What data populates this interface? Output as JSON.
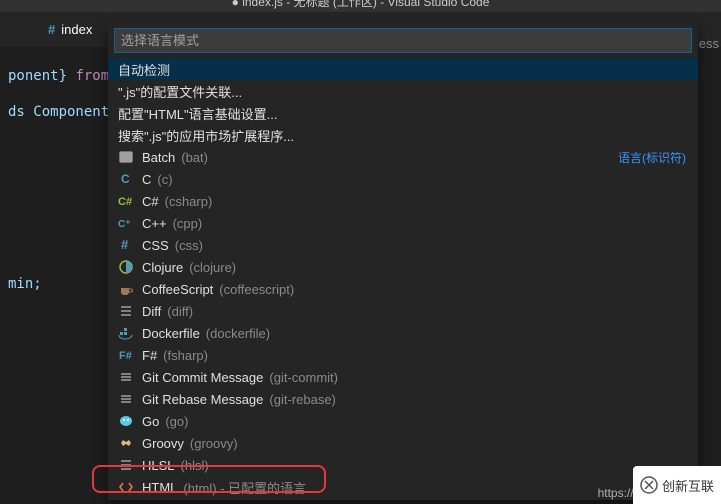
{
  "title": "● index.js - 无标题 (工作区) - Visual Studio Code",
  "tab": {
    "filename": "index"
  },
  "editor": {
    "line1_a": "ponent}",
    "line1_from": "from",
    "line2": "ds Component{",
    "line3": "min;"
  },
  "quickInput": {
    "placeholder": "选择语言模式",
    "rightHint": "语言(标识符)",
    "topItems": [
      "自动检测",
      "\".js\"的配置文件关联...",
      "配置\"HTML\"语言基础设置...",
      "搜索\".js\"的应用市场扩展程序..."
    ],
    "langs": [
      {
        "label": "Batch",
        "desc": "(bat)",
        "icon": "bat"
      },
      {
        "label": "C",
        "desc": "(c)",
        "icon": "c"
      },
      {
        "label": "C#",
        "desc": "(csharp)",
        "icon": "csharp"
      },
      {
        "label": "C++",
        "desc": "(cpp)",
        "icon": "cpp"
      },
      {
        "label": "CSS",
        "desc": "(css)",
        "icon": "css"
      },
      {
        "label": "Clojure",
        "desc": "(clojure)",
        "icon": "clojure"
      },
      {
        "label": "CoffeeScript",
        "desc": "(coffeescript)",
        "icon": "coffee"
      },
      {
        "label": "Diff",
        "desc": "(diff)",
        "icon": "diff"
      },
      {
        "label": "Dockerfile",
        "desc": "(dockerfile)",
        "icon": "docker"
      },
      {
        "label": "F#",
        "desc": "(fsharp)",
        "icon": "fsharp"
      },
      {
        "label": "Git Commit Message",
        "desc": "(git-commit)",
        "icon": "git"
      },
      {
        "label": "Git Rebase Message",
        "desc": "(git-rebase)",
        "icon": "git"
      },
      {
        "label": "Go",
        "desc": "(go)",
        "icon": "go"
      },
      {
        "label": "Groovy",
        "desc": "(groovy)",
        "icon": "groovy"
      },
      {
        "label": "HLSL",
        "desc": "(hlsl)",
        "icon": "hlsl"
      },
      {
        "label": "HTML",
        "desc": "(html)",
        "icon": "html",
        "suffix": " - 已配置的语言",
        "boxed": true
      }
    ]
  },
  "watermark": {
    "url": "https://blog.csdn.net/q",
    "badge": "创新互联"
  },
  "rightTab": "ess"
}
